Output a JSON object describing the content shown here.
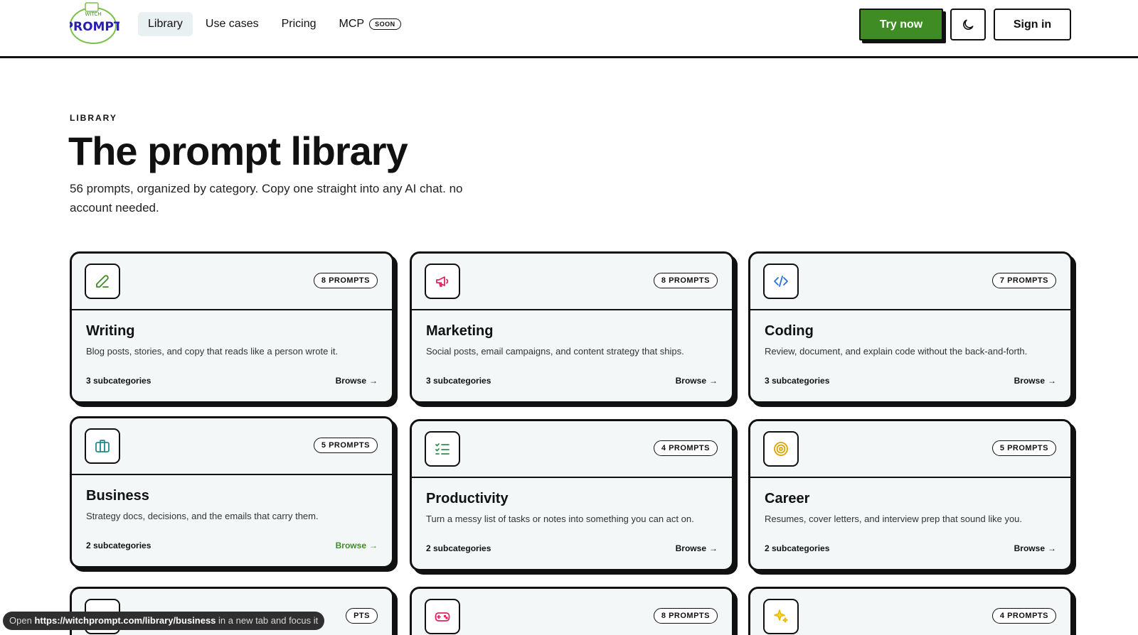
{
  "header": {
    "logo_text": "PROMPT",
    "logo_sub": "WITCH",
    "nav": [
      {
        "label": "Library",
        "active": true
      },
      {
        "label": "Use cases"
      },
      {
        "label": "Pricing"
      },
      {
        "label": "MCP",
        "badge": "SOON"
      }
    ],
    "try_label": "Try now",
    "theme_icon": "moon-icon",
    "signin_label": "Sign in"
  },
  "hero": {
    "eyebrow": "LIBRARY",
    "title": "The prompt library",
    "intro": "56 prompts, organized by category. Copy one straight into any AI chat. no account needed."
  },
  "cards": [
    {
      "title": "Writing",
      "count": "8 PROMPTS",
      "desc": "Blog posts, stories, and copy that reads like a person wrote it.",
      "subs": "3 subcategories",
      "browse": "Browse",
      "icon": "pencil-icon",
      "color": "#3f8c25"
    },
    {
      "title": "Marketing",
      "count": "8 PROMPTS",
      "desc": "Social posts, email campaigns, and content strategy that ships.",
      "subs": "3 subcategories",
      "browse": "Browse",
      "icon": "megaphone-icon",
      "color": "#e0245e"
    },
    {
      "title": "Coding",
      "count": "7 PROMPTS",
      "desc": "Review, document, and explain code without the back-and-forth.",
      "subs": "3 subcategories",
      "browse": "Browse",
      "icon": "code-icon",
      "color": "#2b6fd6"
    },
    {
      "title": "Business",
      "count": "5 PROMPTS",
      "desc": "Strategy docs, decisions, and the emails that carry them.",
      "subs": "2 subcategories",
      "browse": "Browse",
      "icon": "briefcase-icon",
      "color": "#1f8a8a"
    },
    {
      "title": "Productivity",
      "count": "4 PROMPTS",
      "desc": "Turn a messy list of tasks or notes into something you can act on.",
      "subs": "2 subcategories",
      "browse": "Browse",
      "icon": "checklist-icon",
      "color": "#2f8f4f"
    },
    {
      "title": "Career",
      "count": "5 PROMPTS",
      "desc": "Resumes, cover letters, and interview prep that sound like you.",
      "subs": "2 subcategories",
      "browse": "Browse",
      "icon": "target-icon",
      "color": "#d9a400"
    },
    {
      "count": "PTS",
      "icon": "blank-icon"
    },
    {
      "count": "8 PROMPTS",
      "icon": "gamepad-icon",
      "color": "#e0245e"
    },
    {
      "count": "4 PROMPTS",
      "icon": "sparkle-icon",
      "color": "#e6b800"
    }
  ],
  "status": {
    "prefix": "Open",
    "url": "https://witchprompt.com/library/business",
    "suffix": "in a new tab and focus it"
  }
}
